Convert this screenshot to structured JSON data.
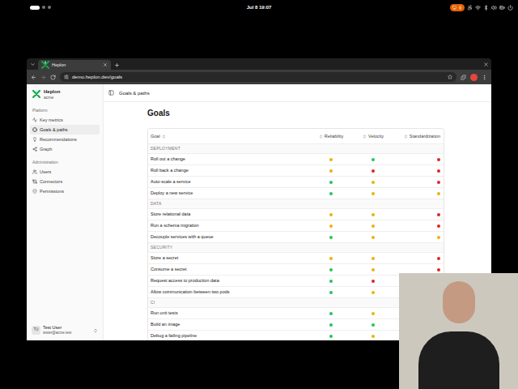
{
  "desktop": {
    "clock": "Jul 8 19:07"
  },
  "browser": {
    "tab_title": "Heplon",
    "url": "demo.heplon.dev/goals"
  },
  "sidebar": {
    "org_name": "Heplon",
    "org_sub": "acme",
    "sections": [
      {
        "label": "Platform",
        "items": [
          {
            "label": "Key metrics",
            "selected": false
          },
          {
            "label": "Goals & paths",
            "selected": true
          },
          {
            "label": "Recommendations",
            "selected": false
          },
          {
            "label": "Graph",
            "selected": false
          }
        ]
      },
      {
        "label": "Administration",
        "items": [
          {
            "label": "Users",
            "selected": false
          },
          {
            "label": "Connectors",
            "selected": false
          },
          {
            "label": "Permissions",
            "selected": false
          }
        ]
      }
    ],
    "user": {
      "initials": "TU",
      "name": "Test User",
      "email": "tester@acme.test"
    }
  },
  "header": {
    "breadcrumb": "Goals & paths"
  },
  "page": {
    "title": "Goals"
  },
  "table": {
    "columns": [
      "Goal",
      "Reliability",
      "Velocity",
      "Standardization"
    ],
    "sections": [
      {
        "label": "DEPLOYMENT",
        "rows": [
          {
            "goal": "Roll out a change",
            "scores": [
              {
                "color": "#eab308"
              },
              {
                "color": "#22c55e"
              },
              {
                "color": "#dc2626"
              }
            ]
          },
          {
            "goal": "Roll back a change",
            "scores": [
              {
                "color": "#eab308"
              },
              {
                "color": "#dc2626"
              },
              {
                "color": "#dc2626"
              }
            ]
          },
          {
            "goal": "Auto-scale a service",
            "scores": [
              {
                "color": "#22c55e"
              },
              {
                "color": "#eab308"
              },
              {
                "color": "#dc2626"
              }
            ]
          },
          {
            "goal": "Deploy a new service",
            "scores": [
              {
                "color": "#22c55e"
              },
              {
                "color": "#eab308"
              },
              {
                "color": "#eab308"
              }
            ]
          }
        ]
      },
      {
        "label": "DATA",
        "rows": [
          {
            "goal": "Store relational data",
            "scores": [
              {
                "color": "#eab308"
              },
              {
                "color": "#eab308"
              },
              {
                "color": "#dc2626"
              }
            ]
          },
          {
            "goal": "Run a schema migration",
            "scores": [
              {
                "color": "#eab308"
              },
              {
                "color": "#eab308"
              },
              {
                "color": "#dc2626"
              }
            ]
          },
          {
            "goal": "Decouple services with a queue",
            "scores": [
              {
                "color": "#22c55e"
              },
              {
                "color": "#eab308"
              },
              {
                "color": "#eab308"
              }
            ]
          }
        ]
      },
      {
        "label": "SECURITY",
        "rows": [
          {
            "goal": "Store a secret",
            "scores": [
              {
                "color": "#eab308"
              },
              {
                "color": "#eab308"
              },
              {
                "color": "#dc2626"
              }
            ]
          },
          {
            "goal": "Consume a secret",
            "scores": [
              {
                "color": "#22c55e"
              },
              {
                "color": "#eab308"
              },
              {
                "color": "#dc2626"
              }
            ]
          },
          {
            "goal": "Request access to production data",
            "scores": [
              {
                "color": "#22c55e"
              },
              {
                "color": "#dc2626"
              }
            ]
          },
          {
            "goal": "Allow communication between two pods",
            "scores": [
              {
                "color": "#22c55e"
              },
              {
                "color": "#eab308"
              }
            ]
          }
        ]
      },
      {
        "label": "CI",
        "rows": [
          {
            "goal": "Run unit tests",
            "scores": [
              {
                "color": "#22c55e"
              },
              {
                "color": "#eab308"
              }
            ]
          },
          {
            "goal": "Build an image",
            "scores": [
              {
                "color": "#22c55e"
              },
              {
                "color": "#22c55e"
              }
            ]
          },
          {
            "goal": "Debug a failing pipeline",
            "scores": [
              {
                "color": "#22c55e"
              },
              {
                "color": "#eab308"
              }
            ]
          }
        ]
      }
    ]
  }
}
